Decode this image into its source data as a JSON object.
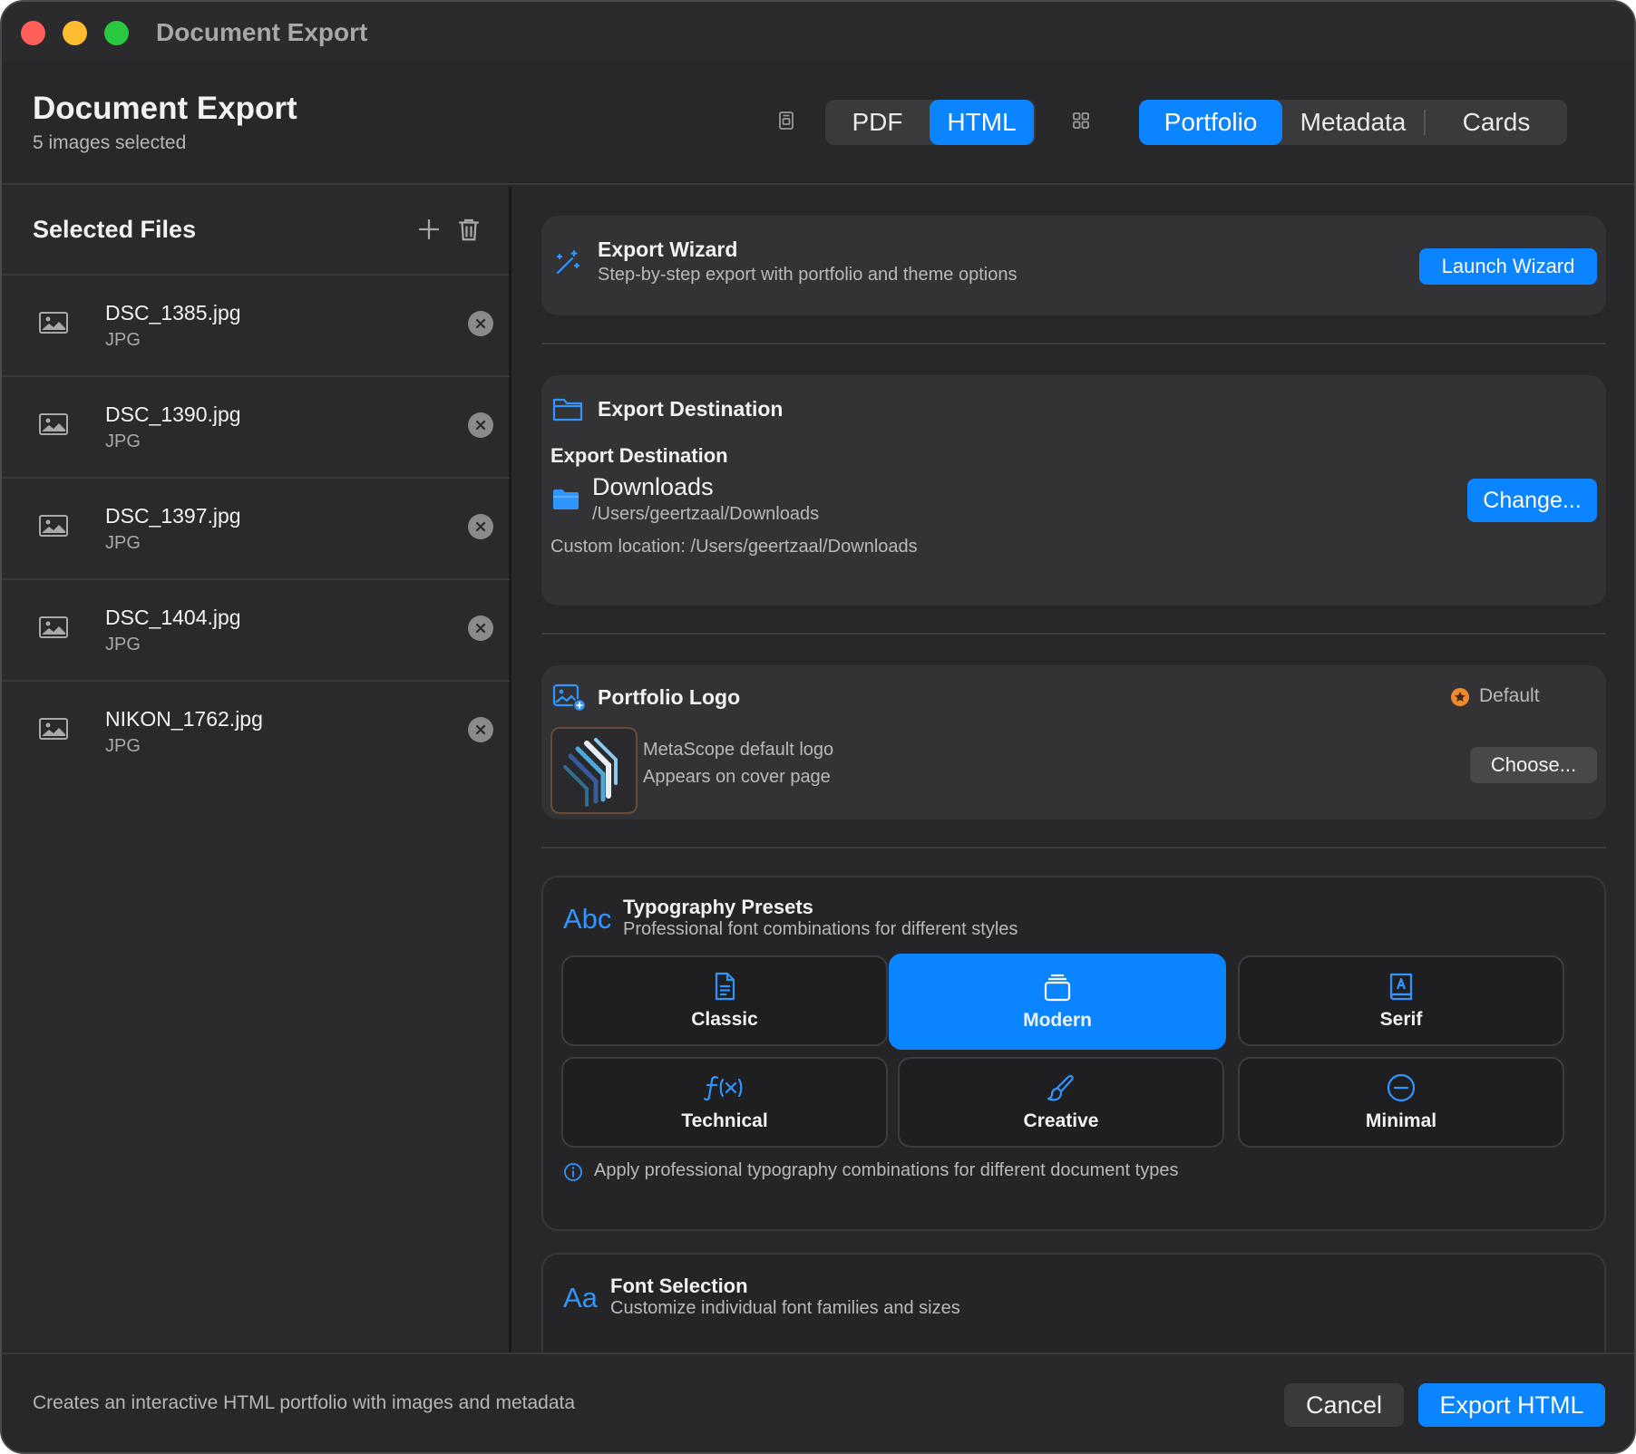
{
  "window": {
    "title": "Document Export"
  },
  "header": {
    "title": "Document Export",
    "subtitle": "5 images selected",
    "format_tabs": [
      {
        "label": "PDF",
        "active": false
      },
      {
        "label": "HTML",
        "active": true
      }
    ],
    "view_tabs": [
      {
        "label": "Portfolio",
        "active": true
      },
      {
        "label": "Metadata",
        "active": false
      },
      {
        "label": "Cards",
        "active": false
      }
    ]
  },
  "sidebar": {
    "title": "Selected Files",
    "files": [
      {
        "name": "DSC_1385.jpg",
        "type": "JPG"
      },
      {
        "name": "DSC_1390.jpg",
        "type": "JPG"
      },
      {
        "name": "DSC_1397.jpg",
        "type": "JPG"
      },
      {
        "name": "DSC_1404.jpg",
        "type": "JPG"
      },
      {
        "name": "NIKON_1762.jpg",
        "type": "JPG"
      }
    ]
  },
  "wizard": {
    "title": "Export Wizard",
    "subtitle": "Step-by-step export with portfolio and theme options",
    "button": "Launch Wizard"
  },
  "destination": {
    "section_title": "Export Destination",
    "label": "Export Destination",
    "folder_name": "Downloads",
    "folder_path": "/Users/geertzaal/Downloads",
    "button": "Change...",
    "custom_location": "Custom location: /Users/geertzaal/Downloads"
  },
  "logo": {
    "section_title": "Portfolio Logo",
    "badge": "Default",
    "name": "MetaScope default logo",
    "description": "Appears on cover page",
    "button": "Choose..."
  },
  "typography": {
    "icon_text": "Abc",
    "title": "Typography Presets",
    "subtitle": "Professional font combinations for different styles",
    "presets": [
      {
        "label": "Classic",
        "icon": "document-icon",
        "active": false
      },
      {
        "label": "Modern",
        "icon": "stack-icon",
        "active": true
      },
      {
        "label": "Serif",
        "icon": "book-icon",
        "active": false
      },
      {
        "label": "Technical",
        "icon": "function-icon",
        "active": false
      },
      {
        "label": "Creative",
        "icon": "paintbrush-icon",
        "active": false
      },
      {
        "label": "Minimal",
        "icon": "minus-circle-icon",
        "active": false
      }
    ],
    "info": "Apply professional typography combinations for different document types"
  },
  "font_selection": {
    "icon_text": "Aa",
    "title": "Font Selection",
    "subtitle": "Customize individual font families and sizes"
  },
  "footer": {
    "description": "Creates an interactive HTML portfolio with images and metadata",
    "cancel": "Cancel",
    "export": "Export HTML"
  },
  "colors": {
    "accent": "#0b84ff",
    "background": "#28282b",
    "card": "#333336",
    "badge_star": "#f0892e"
  }
}
